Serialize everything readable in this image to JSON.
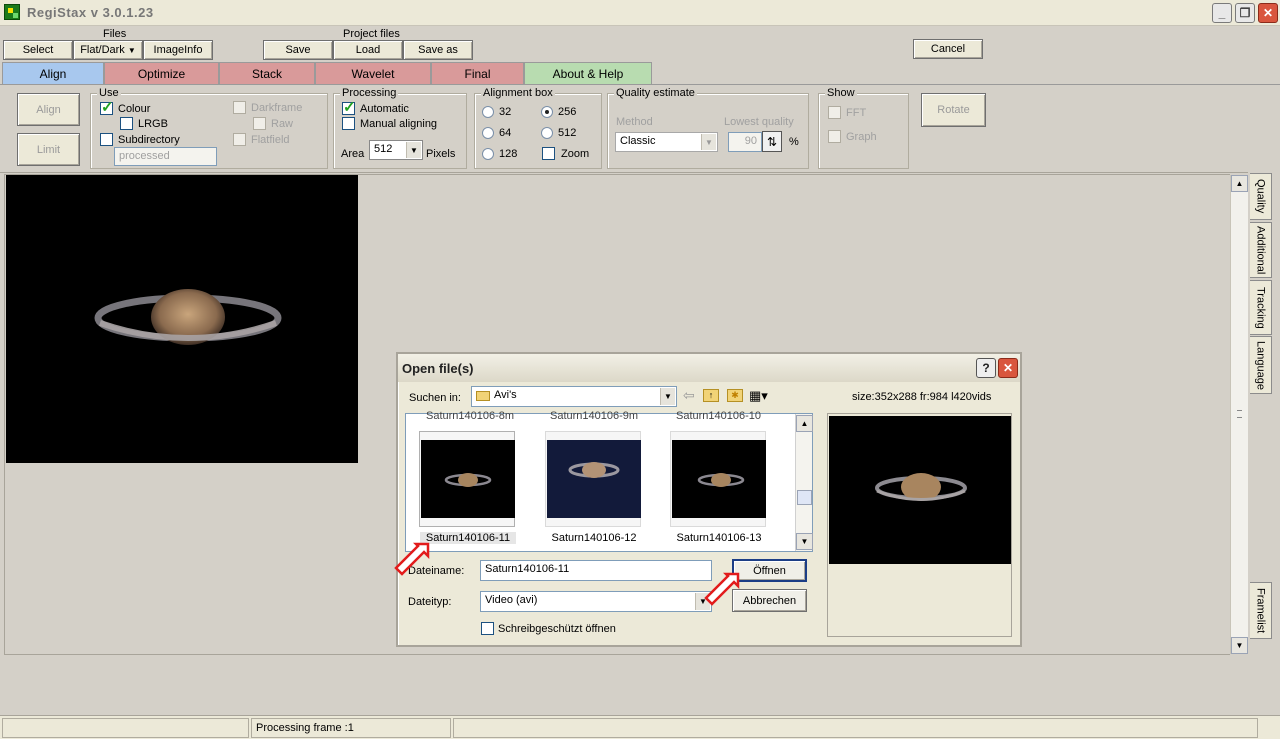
{
  "window": {
    "title": "RegiStax v  3.0.1.23"
  },
  "top": {
    "files_label": "Files",
    "project_files_label": "Project files",
    "select": "Select",
    "flat_dark": "Flat/Dark",
    "imageinfo": "ImageInfo",
    "save": "Save",
    "load": "Load",
    "save_as": "Save as",
    "cancel": "Cancel"
  },
  "tabs": [
    {
      "label": "Align",
      "color": "#a8c8ee"
    },
    {
      "label": "Optimize",
      "color": "#d99a9a"
    },
    {
      "label": "Stack",
      "color": "#d99a9a"
    },
    {
      "label": "Wavelet",
      "color": "#d99a9a"
    },
    {
      "label": "Final",
      "color": "#d99a9a"
    },
    {
      "label": "About & Help",
      "color": "#b8dcb0"
    }
  ],
  "align_panel": {
    "align_button": "Align",
    "limit_button": "Limit",
    "use": {
      "legend": "Use",
      "colour": "Colour",
      "lrgb": "LRGB",
      "subdirectory": "Subdirectory",
      "processed": "processed",
      "darkframe": "Darkframe",
      "raw": "Raw",
      "flatfield": "Flatfield"
    },
    "processing": {
      "legend": "Processing",
      "automatic": "Automatic",
      "manual": "Manual aligning",
      "area_label": "Area",
      "area_value": "512",
      "pixels": "Pixels"
    },
    "alignment_box": {
      "legend": "Alignment box",
      "options": [
        "32",
        "64",
        "128",
        "256",
        "512"
      ],
      "selected": "256",
      "zoom": "Zoom"
    },
    "quality": {
      "legend": "Quality estimate",
      "method_label": "Method",
      "lowest_label": "Lowest quality",
      "method_value": "Classic",
      "lowest_value": "90",
      "percent": "%"
    },
    "show": {
      "legend": "Show",
      "fft": "FFT",
      "graph": "Graph"
    },
    "rotate": "Rotate"
  },
  "side_tabs": [
    "Quality",
    "Additional",
    "Tracking",
    "Language",
    "Framelist"
  ],
  "dialog": {
    "title": "Open file(s)",
    "help": "?",
    "look_in_label": "Suchen in:",
    "look_in_value": "Avi's",
    "size_info": "size:352x288 fr:984 l420vids",
    "partial_labels": [
      "Saturn140106-8m",
      "Saturn140106-9m",
      "Saturn140106-10"
    ],
    "thumbs": [
      {
        "label": "Saturn140106-11"
      },
      {
        "label": "Saturn140106-12"
      },
      {
        "label": "Saturn140106-13"
      }
    ],
    "filename_label": "Dateiname:",
    "filename_value": "Saturn140106-11",
    "filetype_label": "Dateityp:",
    "filetype_value": "Video (avi)",
    "open_button": "Öffnen",
    "cancel_button": "Abbrechen",
    "readonly_label": "Schreibgeschützt öffnen"
  },
  "status": {
    "text": "Processing frame :1"
  },
  "icons": {
    "minimize": "minimize-icon",
    "maximize": "maximize-icon",
    "close": "close-icon",
    "back": "back-arrow-icon",
    "up": "folder-up-icon",
    "new_folder": "new-folder-icon",
    "view": "view-menu-icon",
    "annotation": "red-arrow-annotation"
  }
}
